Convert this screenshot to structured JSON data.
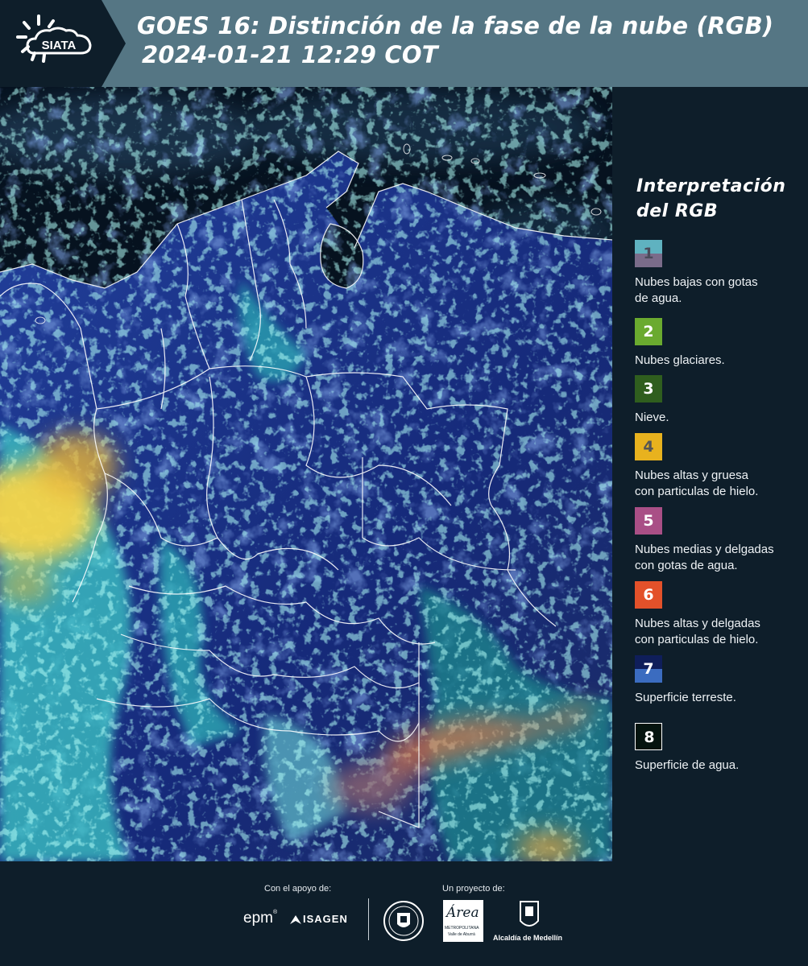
{
  "header": {
    "logo_text": "SIATA",
    "title_line1": "GOES 16: Distinción de la fase de la nube (RGB)",
    "title_line2": "2024-01-21 12:29 COT",
    "background_color": "#557684"
  },
  "map": {
    "region": "Colombia y norte de Suramérica",
    "boundary_color": "#ffffff",
    "land_color": "#1a2f8a",
    "water_color": "#06121f"
  },
  "legend": {
    "title": "Interpretación del RGB",
    "items": [
      {
        "num": "1",
        "label_line1": "Nubes bajas con gotas",
        "label_line2": "de agua.",
        "color_top": "#5fb2c0",
        "color_bottom": "#7a6c8a",
        "num_color": "#4a4a5a"
      },
      {
        "num": "2",
        "label_line1": "Nubes glaciares.",
        "label_line2": "",
        "color_top": "#6aaa2f",
        "color_bottom": "#6aaa2f",
        "num_color": "#ffffff"
      },
      {
        "num": "3",
        "label_line1": "Nieve.",
        "label_line2": "",
        "color_top": "#2f5e1e",
        "color_bottom": "#2f5e1e",
        "num_color": "#ffffff"
      },
      {
        "num": "4",
        "label_line1": "Nubes altas y gruesa",
        "label_line2": "con particulas de hielo.",
        "color_top": "#e8b21e",
        "color_bottom": "#e8b21e",
        "num_color": "#555555"
      },
      {
        "num": "5",
        "label_line1": "Nubes medias y delgadas",
        "label_line2": "con gotas de agua.",
        "color_top": "#a94f86",
        "color_bottom": "#a94f86",
        "num_color": "#ffffff"
      },
      {
        "num": "6",
        "label_line1": "Nubes altas y delgadas",
        "label_line2": "con particulas de hielo.",
        "color_top": "#e3512a",
        "color_bottom": "#e3512a",
        "num_color": "#ffffff"
      },
      {
        "num": "7",
        "label_line1": "Superficie terreste.",
        "label_line2": "",
        "color_top": "#0f1e5a",
        "color_bottom": "#3b6cc0",
        "num_color": "#ffffff"
      },
      {
        "num": "8",
        "label_line1": "Superficie de agua.",
        "label_line2": "",
        "color_top": "#05140f",
        "color_bottom": "#05140f",
        "num_color": "#ffffff"
      }
    ]
  },
  "footer": {
    "support_label": "Con el apoyo de:",
    "project_label": "Un proyecto de:",
    "epm_text": "epm",
    "isagen_text": "ISAGEN",
    "metropolitana_text": "METROPOLITANA",
    "valle_text": "Valle de Aburrá",
    "area_text": "Área",
    "alcaldia_text": "Alcaldía de Medellín"
  }
}
